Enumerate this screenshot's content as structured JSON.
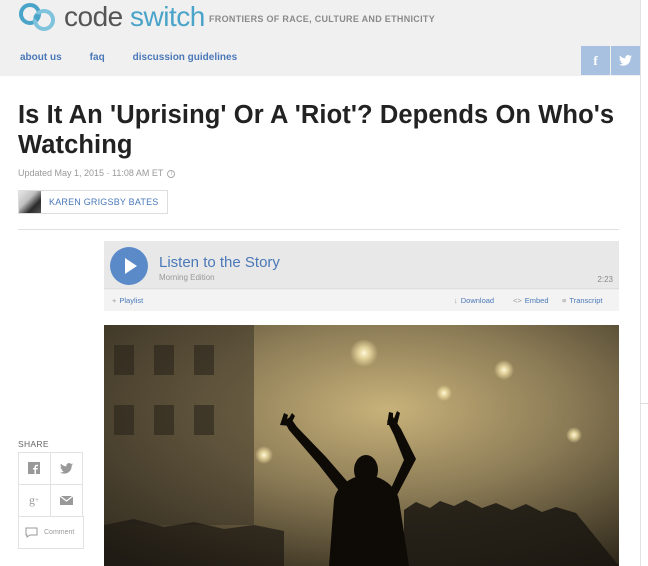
{
  "brand": {
    "name_part1": "code",
    "name_part2": "switch",
    "tagline": "FRONTIERS OF RACE, CULTURE AND ETHNICITY"
  },
  "nav": {
    "items": [
      "about us",
      "faq",
      "discussion guidelines"
    ]
  },
  "social_top": {
    "facebook_glyph": "f",
    "twitter_glyph": "🐦"
  },
  "article": {
    "title": "Is It An 'Uprising' Or A 'Riot'? Depends On Who's Watching",
    "updated": "Updated May 1, 2015 · 11:08 AM ET",
    "author": "KAREN GRIGSBY BATES"
  },
  "player": {
    "title": "Listen to the Story",
    "program": "Morning Edition",
    "duration": "2:23",
    "playlist_label": "Playlist",
    "download_label": "Download",
    "embed_label": "Embed",
    "transcript_label": "Transcript"
  },
  "share": {
    "label": "SHARE",
    "comment_label": "Comment"
  },
  "colors": {
    "accent_blue": "#4a78b8",
    "play_button": "#5b8ac9",
    "logo_teal": "#4aa3c8"
  }
}
